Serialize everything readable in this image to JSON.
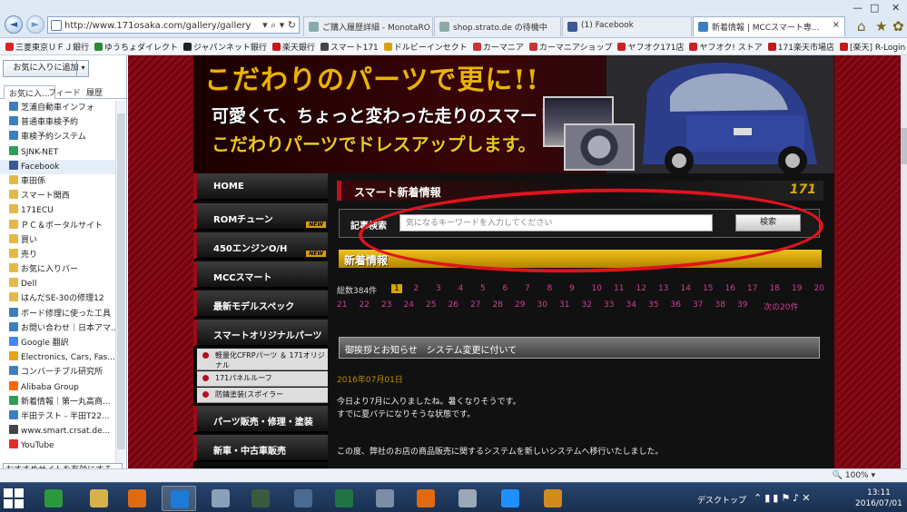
{
  "browser": {
    "url": "http://www.171osaka.com/gallery/gallery",
    "address_controls": "▾ ⌕ ▾ ↻",
    "tabs": [
      {
        "label": "ご購入履歴詳細 - MonotaRO"
      },
      {
        "label": "shop.strato.de の待機中"
      },
      {
        "label": "(1) Facebook"
      },
      {
        "label": "新着情報 | MCCスマート専..."
      }
    ],
    "window_controls": [
      "—",
      "□",
      "✕"
    ],
    "toolbar_icons": [
      "⌂",
      "★",
      "✿"
    ]
  },
  "favorites_bar": [
    {
      "label": "三菱東京ＵＦＪ銀行",
      "color": "#d22"
    },
    {
      "label": "ゆうちょダイレクト",
      "color": "#2a8a3a"
    },
    {
      "label": "ジャパンネット銀行",
      "color": "#222"
    },
    {
      "label": "楽天銀行",
      "color": "#c21a1a"
    },
    {
      "label": "スマート171",
      "color": "#444"
    },
    {
      "label": "ドルビーインセクト",
      "color": "#d9a20d"
    },
    {
      "label": "カーマニア",
      "color": "#c33"
    },
    {
      "label": "カーマニアショップ",
      "color": "#c33"
    },
    {
      "label": "ヤフオク171店",
      "color": "#c22"
    },
    {
      "label": "ヤフオク! ストア",
      "color": "#c22"
    },
    {
      "label": "171楽天市場店",
      "color": "#c21a1a"
    },
    {
      "label": "[楽天] R-Login",
      "color": "#c21a1a"
    },
    {
      "label": "Google",
      "color": "#4285f4"
    }
  ],
  "favorites_pane": {
    "add_button": "お気に入りに追加",
    "tabs": [
      "お気に入...",
      "フィード",
      "履歴"
    ],
    "items": [
      {
        "label": "芝浦自動車インフォ",
        "color": "#3c7fc1"
      },
      {
        "label": "普通車車検予約",
        "color": "#3c7fc1"
      },
      {
        "label": "車検予約システム",
        "color": "#3c7fc1"
      },
      {
        "label": "SJNK-NET",
        "color": "#2e9e57"
      },
      {
        "label": "Facebook",
        "color": "#3b5998"
      },
      {
        "label": "車田係",
        "color": "#e6b84a"
      },
      {
        "label": "スマート関西",
        "color": "#e6b84a"
      },
      {
        "label": "171ECU",
        "color": "#e6b84a"
      },
      {
        "label": "ＰＣ＆ポータルサイト",
        "color": "#e6b84a"
      },
      {
        "label": "買い",
        "color": "#e6b84a"
      },
      {
        "label": "売り",
        "color": "#e6b84a"
      },
      {
        "label": "お気に入りバー",
        "color": "#e6b84a"
      },
      {
        "label": "Dell",
        "color": "#e6b84a"
      },
      {
        "label": "はんだSE-30の修理12",
        "color": "#e6b84a"
      },
      {
        "label": "ボード修理に使った工具",
        "color": "#3c7fc1"
      },
      {
        "label": "お問い合わせ｜日本アマ...",
        "color": "#3c7fc1"
      },
      {
        "label": "Google 翻訳",
        "color": "#4285f4"
      },
      {
        "label": "Electronics, Cars, Fas...",
        "color": "#e8a317"
      },
      {
        "label": "コンバーチブル研究所",
        "color": "#3c7fc1"
      },
      {
        "label": "Alibaba Group",
        "color": "#f60"
      },
      {
        "label": "新着情報｜第一丸高商...",
        "color": "#2e9e57"
      },
      {
        "label": "半田テスト - 半田T22...",
        "color": "#3c7fc1"
      },
      {
        "label": "www.smart.crsat.de...",
        "color": "#444"
      },
      {
        "label": "YouTube",
        "color": "#e52d27"
      }
    ],
    "recommend_button": "おすすめサイトを有効にする..."
  },
  "site": {
    "banner": {
      "headline": "こだわりのパーツで更に!!",
      "line2": "可愛くて、ちょっと変わった走りのスマートを",
      "line3": "こだわりパーツでドレスアップします。"
    },
    "nav": [
      {
        "label": "HOME",
        "new": ""
      },
      {
        "label": "ROMチューン",
        "new": "NEW"
      },
      {
        "label": "450エンジンO/H",
        "new": "NEW"
      },
      {
        "label": "MCCスマート",
        "new": ""
      },
      {
        "label": "最新モデルスペック",
        "new": ""
      },
      {
        "label": "スマートオリジナルパーツ",
        "new": ""
      }
    ],
    "subnav": [
      {
        "label": "軽量化CFRPパーツ ＆ 171オリジナル"
      },
      {
        "label": "171パネルルーフ"
      },
      {
        "label": "防錆塗装(スポイラー"
      }
    ],
    "nav2": [
      {
        "label": "パーツ販売・修理・塗装"
      },
      {
        "label": "新車・中古車販売"
      }
    ],
    "news_heading": "スマート新着情報",
    "logo": "171",
    "search_label": "記事検索",
    "search_placeholder": "気になるキーワードを入力してください",
    "search_button": "検索",
    "new_arrivals": "新着情報",
    "total": "総数384件",
    "pages_row1": [
      "1",
      "2",
      "3",
      "4",
      "5",
      "6",
      "7",
      "8",
      "9",
      "10",
      "11",
      "12",
      "13",
      "14",
      "15",
      "16",
      "17",
      "18",
      "19",
      "20"
    ],
    "pages_row2": [
      "21",
      "22",
      "23",
      "24",
      "25",
      "26",
      "27",
      "28",
      "29",
      "30",
      "31",
      "32",
      "33",
      "34",
      "35",
      "36",
      "37",
      "38",
      "39"
    ],
    "next_label": "次の20件",
    "post_title": "御挨拶とお知らせ　システム変更に付いて",
    "post_date": "2016年07月01日",
    "post_body1": "今日より7月に入りましたね。暑くなりそうです。",
    "post_body1b": "すでに夏バテになりそうな状態です。",
    "post_body2": "この度、弊社のお店の商品販売に関するシステムを新しいシステムへ移行いたしました。"
  },
  "statusbar": {
    "zoom": "100%"
  },
  "taskbar": {
    "apps": [
      {
        "name": "store-app",
        "color": "#2c9a3c"
      },
      {
        "name": "explorer-app",
        "color": "#d7b24a"
      },
      {
        "name": "media-app",
        "color": "#e06a12"
      },
      {
        "name": "ie-app",
        "color": "#1e7ad6"
      },
      {
        "name": "folders-app",
        "color": "#8aa0b8"
      },
      {
        "name": "game-app",
        "color": "#3c5a3c"
      },
      {
        "name": "monitor-app",
        "color": "#4a6a92"
      },
      {
        "name": "excel-app",
        "color": "#217346"
      },
      {
        "name": "paint-app",
        "color": "#7b8ea6"
      },
      {
        "name": "player-app",
        "color": "#e06a12"
      },
      {
        "name": "device-app",
        "color": "#9aa8b8"
      },
      {
        "name": "orb-app",
        "color": "#1e90ff"
      },
      {
        "name": "maker-app",
        "color": "#d38a1a"
      }
    ],
    "desktop_label": "デスクトップ",
    "time": "13:11",
    "date": "2016/07/01"
  }
}
